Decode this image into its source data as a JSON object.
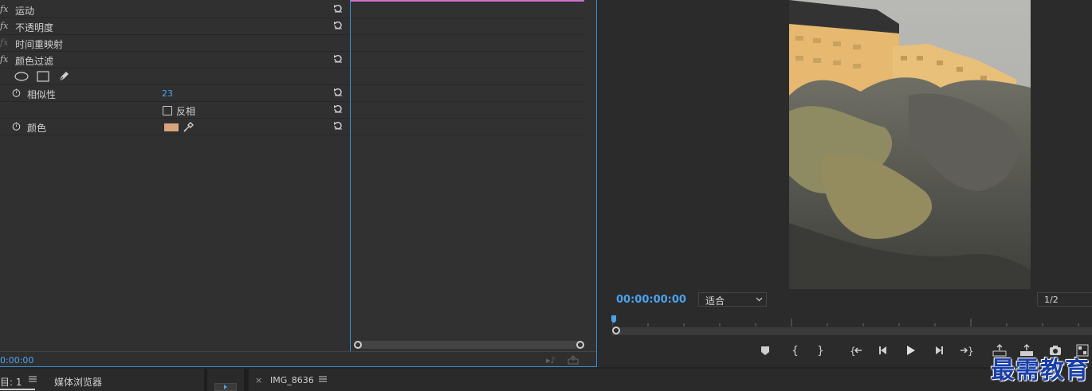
{
  "effect_controls": {
    "effects": [
      {
        "fx": "fx",
        "label": "运动",
        "enabled": true
      },
      {
        "fx": "fx",
        "label": "不透明度",
        "enabled": true
      },
      {
        "fx": "fx",
        "label": "时间重映射",
        "enabled": false
      },
      {
        "fx": "fx",
        "label": "颜色过滤",
        "enabled": true
      }
    ],
    "similarity": {
      "label": "相似性",
      "value": "23"
    },
    "invert": {
      "label": "反相",
      "checked": false
    },
    "color": {
      "label": "颜色",
      "swatch": "#d9a47d"
    },
    "timecode": "0:00:00"
  },
  "program_monitor": {
    "timecode": "00:00:00:00",
    "zoom": "适合",
    "resolution": "1/2"
  },
  "bottom_tabs": {
    "project": "目: 1",
    "media_browser": "媒体浏览器",
    "sequence": "IMG_8636"
  },
  "watermark": "最需教育",
  "colors": {
    "accent_blue": "#4aa3ef",
    "work_area": "#d070d0"
  }
}
